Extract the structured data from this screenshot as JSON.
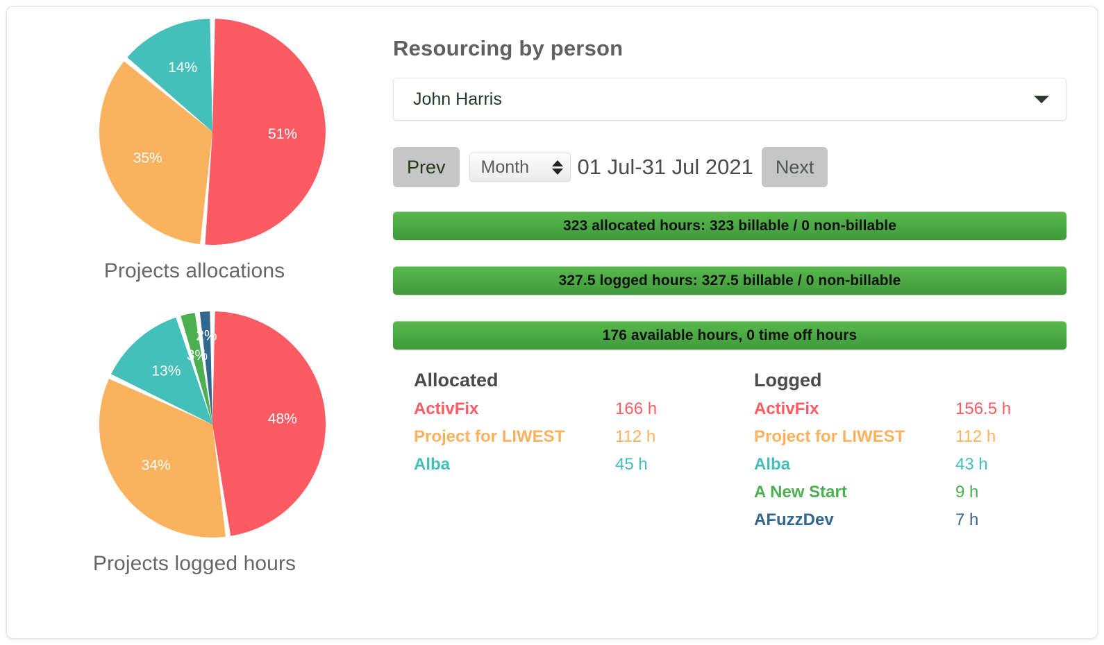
{
  "charts": {
    "allocations": {
      "caption": "Projects allocations",
      "labels": [
        "51%",
        "35%",
        "14%"
      ]
    },
    "logged": {
      "caption": "Projects logged hours",
      "labels": [
        "48%",
        "34%",
        "13%",
        "3%",
        "2%"
      ]
    }
  },
  "chart_data": [
    {
      "type": "pie",
      "title": "Projects allocations",
      "categories": [
        "ActivFix",
        "Project for LIWEST",
        "Alba"
      ],
      "values": [
        166,
        112,
        45
      ],
      "value_unit": "h",
      "percent_labels": [
        "51%",
        "35%",
        "14%"
      ],
      "percents": [
        51,
        35,
        14
      ],
      "colors": [
        "#FB5B63",
        "#FBB25E",
        "#45BFBA"
      ],
      "start_angle_deg": 0,
      "direction": "clockwise",
      "legend": "none",
      "total": 323
    },
    {
      "type": "pie",
      "title": "Projects logged hours",
      "categories": [
        "ActivFix",
        "Project for LIWEST",
        "Alba",
        "A New Start",
        "AFuzzDev"
      ],
      "values": [
        156.5,
        112,
        43,
        9,
        7
      ],
      "value_unit": "h",
      "percent_labels": [
        "48%",
        "34%",
        "13%",
        "3%",
        "2%"
      ],
      "percents": [
        48,
        34,
        13,
        3,
        2
      ],
      "colors": [
        "#FB5B63",
        "#FBB25E",
        "#45BFBA",
        "#4CAF50",
        "#33688E"
      ],
      "start_angle_deg": 0,
      "direction": "clockwise",
      "legend": "none",
      "total": 327.5
    }
  ],
  "panel": {
    "title": "Resourcing by person",
    "person": {
      "selected": "John Harris",
      "caret_icon": "chevron-down-icon"
    },
    "period": {
      "prev_label": "Prev",
      "next_label": "Next",
      "unit_selected": "Month",
      "range_label": "01 Jul-31 Jul 2021",
      "spinner_icon": "updown-spinner-icon"
    },
    "summary_bars": [
      "323 allocated hours: 323 billable / 0 non-billable",
      "327.5 logged hours: 327.5 billable / 0 non-billable",
      "176 available hours, 0 time off hours"
    ],
    "allocated": {
      "heading": "Allocated",
      "rows": [
        {
          "name": "ActivFix",
          "hours": "166 h",
          "color": "#FB5B63"
        },
        {
          "name": "Project for LIWEST",
          "hours": "112 h",
          "color": "#FBB25E"
        },
        {
          "name": "Alba",
          "hours": "45 h",
          "color": "#45BFBA"
        }
      ]
    },
    "logged": {
      "heading": "Logged",
      "rows": [
        {
          "name": "ActivFix",
          "hours": "156.5 h",
          "color": "#FB5B63"
        },
        {
          "name": "Project for LIWEST",
          "hours": "112 h",
          "color": "#FBB25E"
        },
        {
          "name": "Alba",
          "hours": "43 h",
          "color": "#45BFBA"
        },
        {
          "name": "A New Start",
          "hours": "9 h",
          "color": "#4CAF50"
        },
        {
          "name": "AFuzzDev",
          "hours": "7 h",
          "color": "#33688E"
        }
      ]
    }
  },
  "colors": {
    "red": "#FB5B63",
    "orange": "#FBB25E",
    "teal": "#45BFBA",
    "green": "#4CAF50",
    "blue": "#33688E",
    "bar_green": "#4AA843"
  }
}
